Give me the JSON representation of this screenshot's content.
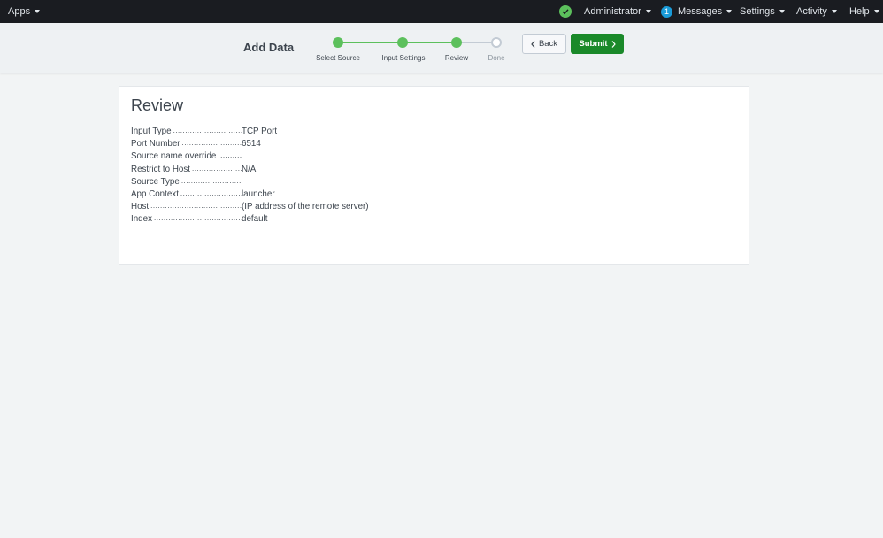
{
  "topbar": {
    "apps_label": "Apps",
    "status_icon": "check-circle-icon",
    "user_label": "Administrator",
    "messages_count": "1",
    "messages_label": "Messages",
    "settings_label": "Settings",
    "activity_label": "Activity",
    "help_label": "Help"
  },
  "wizard": {
    "title": "Add Data",
    "steps": [
      {
        "label": "Select Source",
        "state": "complete"
      },
      {
        "label": "Input Settings",
        "state": "complete"
      },
      {
        "label": "Review",
        "state": "current"
      },
      {
        "label": "Done",
        "state": "pending"
      }
    ],
    "back_label": "Back",
    "submit_label": "Submit"
  },
  "review": {
    "heading": "Review",
    "rows": [
      {
        "label": "Input Type",
        "value": "TCP Port"
      },
      {
        "label": "Port Number",
        "value": "6514"
      },
      {
        "label": "Source name override",
        "value": ""
      },
      {
        "label": "Restrict to Host",
        "value": "N/A"
      },
      {
        "label": "Source Type",
        "value": ""
      },
      {
        "label": "App Context",
        "value": "launcher"
      },
      {
        "label": "Host",
        "value": "(IP address of the remote server)"
      },
      {
        "label": "Index",
        "value": "default"
      }
    ]
  },
  "colors": {
    "topbar_bg": "#1a1c21",
    "accent_green": "#5cc05c",
    "submit_green": "#1a8929",
    "badge_blue": "#1a9bd8"
  }
}
